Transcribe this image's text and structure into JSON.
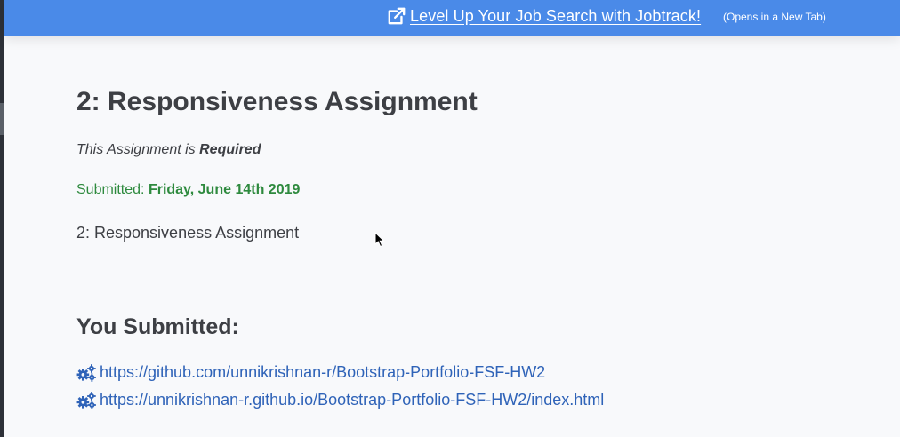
{
  "banner": {
    "link_label": "Level Up Your Job Search with Jobtrack!",
    "note": "(Opens in a New Tab)",
    "icon": "external-link-icon",
    "color": "#4a8ae8"
  },
  "assignment": {
    "title": "2: Responsiveness Assignment",
    "requirement_prefix": "This Assignment is",
    "requirement_value": "Required",
    "submitted_prefix": "Submitted:",
    "submitted_date": "Friday, June 14th 2019",
    "description": "2: Responsiveness Assignment"
  },
  "submissions": {
    "heading": "You Submitted:",
    "icon": "gears-icon",
    "links": [
      {
        "label": "https://github.com/unnikrishnan-r/Bootstrap-Portfolio-FSF-HW2"
      },
      {
        "label": "https://unnikrishnan-r.github.io/Bootstrap-Portfolio-FSF-HW2/index.html"
      }
    ]
  },
  "colors": {
    "accent": "#4a8ae8",
    "success": "#2e8a3e",
    "link": "#2f63b8",
    "text": "#3d3f44"
  }
}
